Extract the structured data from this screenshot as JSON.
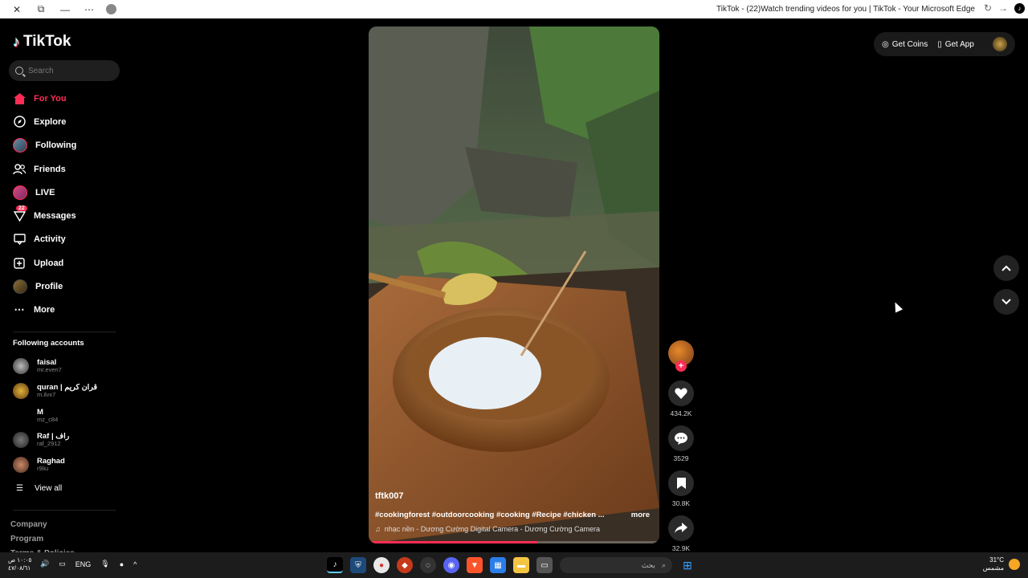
{
  "browser": {
    "title": "TikTok - (22)Watch trending videos for you | TikTok - Your Microsoft Edge"
  },
  "sidebar": {
    "logo": "TikTok",
    "search_placeholder": "Search",
    "nav": [
      {
        "label": "For You",
        "icon": "home-icon",
        "active": true
      },
      {
        "label": "Explore",
        "icon": "compass-icon"
      },
      {
        "label": "Following",
        "icon": "avatar"
      },
      {
        "label": "Friends",
        "icon": "friends-icon"
      },
      {
        "label": "LIVE",
        "icon": "live-avatar"
      },
      {
        "label": "Messages",
        "icon": "messages-icon",
        "badge": "22"
      },
      {
        "label": "Activity",
        "icon": "activity-icon"
      },
      {
        "label": "Upload",
        "icon": "upload-icon"
      },
      {
        "label": "Profile",
        "icon": "profile-avatar"
      },
      {
        "label": "More",
        "icon": "more-icon"
      }
    ],
    "following_title": "Following accounts",
    "accounts": [
      {
        "name": "faisal",
        "user": "mr.even7"
      },
      {
        "name": "quran | قرآن كريم",
        "user": "m.ilvx7"
      },
      {
        "name": "M",
        "user": "mz_c84"
      },
      {
        "name": "Raf | راف",
        "user": "raf_2912"
      },
      {
        "name": "Raghad",
        "user": "r9liu"
      }
    ],
    "view_all": "View all",
    "footer": [
      "Company",
      "Program",
      "Terms & Policies"
    ]
  },
  "video": {
    "author": "tftk007",
    "caption": "#cookingforest #outdoorcooking #cooking #Recipe #chicken ...",
    "more": "more",
    "music": "nhạc nền - Dương Cường Digital Camera - Dương Cường Camera",
    "progress": 0.58
  },
  "actions": {
    "likes": "434.2K",
    "comments": "3529",
    "saves": "30.8K",
    "shares": "32.9K"
  },
  "topbar": {
    "get_coins": "Get Coins",
    "get_app": "Get App"
  },
  "taskbar": {
    "time": "١٠:٠٥ ص",
    "date": "٤٧/٠٨/٦١",
    "lang": "ENG",
    "search_text": "بحث",
    "temp": "31°C",
    "weather": "مشمس"
  }
}
